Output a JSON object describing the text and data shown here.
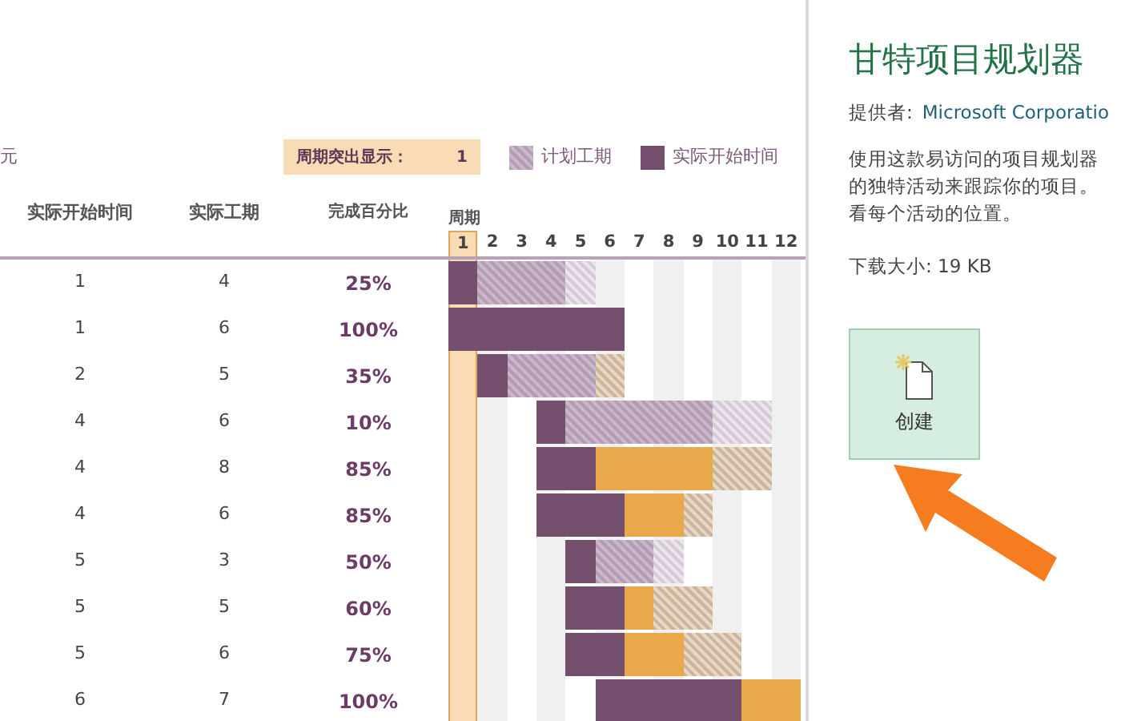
{
  "preview": {
    "title_fragment": "元",
    "highlight": {
      "label": "周期突出显示：",
      "value": "1"
    },
    "legend": [
      {
        "label": "计划工期",
        "kind": "plan"
      },
      {
        "label": "实际开始时间",
        "kind": "done"
      }
    ],
    "columns": [
      "实际开始时间",
      "实际工期",
      "完成百分比"
    ],
    "period_label": "周期",
    "periods": [
      {
        "label": "1",
        "selected": true
      },
      {
        "label": "2",
        "selected": false
      },
      {
        "label": "3",
        "selected": false
      },
      {
        "label": "4",
        "selected": false
      },
      {
        "label": "5",
        "selected": false
      },
      {
        "label": "6",
        "selected": false
      },
      {
        "label": "7",
        "selected": false
      },
      {
        "label": "8",
        "selected": false
      },
      {
        "label": "9",
        "selected": false
      },
      {
        "label": "10",
        "selected": false
      },
      {
        "label": "11",
        "selected": false
      },
      {
        "label": "12",
        "selected": false
      }
    ],
    "rows": [
      {
        "start": "1",
        "duration": "4",
        "percent": "25%",
        "cells": [
          {
            "kind": "done"
          },
          {
            "kind": "plan"
          },
          {
            "kind": "plan"
          },
          {
            "kind": "plan"
          },
          {
            "kind": "plan_light"
          },
          {
            "kind": "none"
          },
          {
            "kind": "none"
          },
          {
            "kind": "none"
          },
          {
            "kind": "none"
          },
          {
            "kind": "none"
          },
          {
            "kind": "none"
          },
          {
            "kind": "none"
          }
        ]
      },
      {
        "start": "1",
        "duration": "6",
        "percent": "100%",
        "cells": [
          {
            "kind": "done"
          },
          {
            "kind": "done"
          },
          {
            "kind": "done"
          },
          {
            "kind": "done"
          },
          {
            "kind": "done"
          },
          {
            "kind": "done"
          },
          {
            "kind": "none"
          },
          {
            "kind": "none"
          },
          {
            "kind": "none"
          },
          {
            "kind": "none"
          },
          {
            "kind": "none"
          },
          {
            "kind": "none"
          }
        ]
      },
      {
        "start": "2",
        "duration": "5",
        "percent": "35%",
        "cells": [
          {
            "kind": "none"
          },
          {
            "kind": "done"
          },
          {
            "kind": "plan"
          },
          {
            "kind": "plan"
          },
          {
            "kind": "plan"
          },
          {
            "kind": "late_hatch"
          },
          {
            "kind": "none"
          },
          {
            "kind": "none"
          },
          {
            "kind": "none"
          },
          {
            "kind": "none"
          },
          {
            "kind": "none"
          },
          {
            "kind": "none"
          }
        ]
      },
      {
        "start": "4",
        "duration": "6",
        "percent": "10%",
        "cells": [
          {
            "kind": "none"
          },
          {
            "kind": "none"
          },
          {
            "kind": "none"
          },
          {
            "kind": "done"
          },
          {
            "kind": "plan"
          },
          {
            "kind": "plan"
          },
          {
            "kind": "plan"
          },
          {
            "kind": "plan"
          },
          {
            "kind": "plan"
          },
          {
            "kind": "plan_light"
          },
          {
            "kind": "plan_light"
          },
          {
            "kind": "none"
          }
        ]
      },
      {
        "start": "4",
        "duration": "8",
        "percent": "85%",
        "cells": [
          {
            "kind": "none"
          },
          {
            "kind": "none"
          },
          {
            "kind": "none"
          },
          {
            "kind": "done"
          },
          {
            "kind": "done"
          },
          {
            "kind": "late"
          },
          {
            "kind": "late"
          },
          {
            "kind": "late"
          },
          {
            "kind": "late"
          },
          {
            "kind": "late_hatch"
          },
          {
            "kind": "late_hatch"
          },
          {
            "kind": "none"
          }
        ]
      },
      {
        "start": "4",
        "duration": "6",
        "percent": "85%",
        "cells": [
          {
            "kind": "none"
          },
          {
            "kind": "none"
          },
          {
            "kind": "none"
          },
          {
            "kind": "done"
          },
          {
            "kind": "done"
          },
          {
            "kind": "done"
          },
          {
            "kind": "late"
          },
          {
            "kind": "late"
          },
          {
            "kind": "late_hatch"
          },
          {
            "kind": "none"
          },
          {
            "kind": "none"
          },
          {
            "kind": "none"
          }
        ]
      },
      {
        "start": "5",
        "duration": "3",
        "percent": "50%",
        "cells": [
          {
            "kind": "none"
          },
          {
            "kind": "none"
          },
          {
            "kind": "none"
          },
          {
            "kind": "none"
          },
          {
            "kind": "done"
          },
          {
            "kind": "plan"
          },
          {
            "kind": "plan"
          },
          {
            "kind": "plan_light"
          },
          {
            "kind": "none"
          },
          {
            "kind": "none"
          },
          {
            "kind": "none"
          },
          {
            "kind": "none"
          }
        ]
      },
      {
        "start": "5",
        "duration": "5",
        "percent": "60%",
        "cells": [
          {
            "kind": "none"
          },
          {
            "kind": "none"
          },
          {
            "kind": "none"
          },
          {
            "kind": "none"
          },
          {
            "kind": "done"
          },
          {
            "kind": "done"
          },
          {
            "kind": "late"
          },
          {
            "kind": "late_hatch"
          },
          {
            "kind": "late_hatch"
          },
          {
            "kind": "none"
          },
          {
            "kind": "none"
          },
          {
            "kind": "none"
          }
        ]
      },
      {
        "start": "5",
        "duration": "6",
        "percent": "75%",
        "cells": [
          {
            "kind": "none"
          },
          {
            "kind": "none"
          },
          {
            "kind": "none"
          },
          {
            "kind": "none"
          },
          {
            "kind": "done"
          },
          {
            "kind": "done"
          },
          {
            "kind": "late"
          },
          {
            "kind": "late"
          },
          {
            "kind": "late_hatch"
          },
          {
            "kind": "late_hatch"
          },
          {
            "kind": "none"
          },
          {
            "kind": "none"
          }
        ]
      },
      {
        "start": "6",
        "duration": "7",
        "percent": "100%",
        "cells": [
          {
            "kind": "none"
          },
          {
            "kind": "none"
          },
          {
            "kind": "none"
          },
          {
            "kind": "none"
          },
          {
            "kind": "none"
          },
          {
            "kind": "done"
          },
          {
            "kind": "done"
          },
          {
            "kind": "done"
          },
          {
            "kind": "done"
          },
          {
            "kind": "done"
          },
          {
            "kind": "late"
          },
          {
            "kind": "late"
          }
        ]
      }
    ]
  },
  "details": {
    "title": "甘特项目规划器",
    "provider_label": "提供者:",
    "provider": "Microsoft Corporatio",
    "description": [
      "使用这款易访问的项目规划器",
      "的独特活动来跟踪你的项目。",
      "看每个活动的位置。"
    ],
    "size_label": "下载大小:",
    "size": "19 KB"
  },
  "create_button": {
    "label": "创建"
  }
}
